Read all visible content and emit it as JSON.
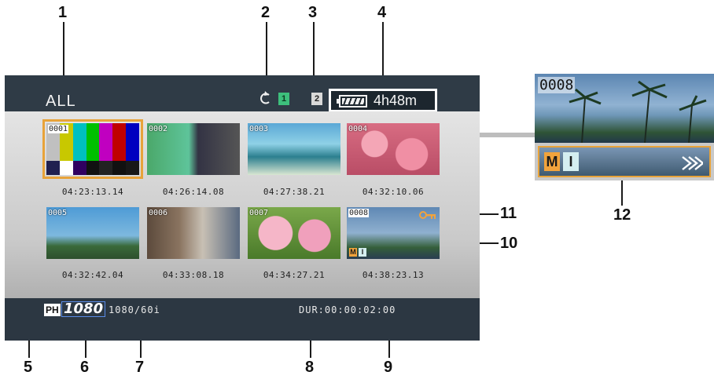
{
  "callouts": [
    "1",
    "2",
    "3",
    "4",
    "5",
    "6",
    "7",
    "8",
    "9",
    "10",
    "11",
    "12"
  ],
  "screen": {
    "title": "ALL",
    "slot1_label": "1",
    "slot2_label": "2",
    "battery_time": "4h48m",
    "format_badge": "PH",
    "resolution_badge": "1080",
    "recording_format": "1080/60i",
    "duration": "DUR:00:00:02:00"
  },
  "clips": [
    {
      "number": "0001",
      "timecode": "04:23:13.14",
      "selected": true
    },
    {
      "number": "0002",
      "timecode": "04:26:14.08"
    },
    {
      "number": "0003",
      "timecode": "04:27:38.21"
    },
    {
      "number": "0004",
      "timecode": "04:32:10.06"
    },
    {
      "number": "0005",
      "timecode": "04:32:42.04"
    },
    {
      "number": "0006",
      "timecode": "04:33:08.18"
    },
    {
      "number": "0007",
      "timecode": "04:34:27.21"
    },
    {
      "number": "0008",
      "timecode": "04:38:23.13",
      "marked": "M",
      "index": "I",
      "protected": true
    }
  ],
  "zoom": {
    "number": "0008",
    "mark_label": "M",
    "index_label": "I",
    "icons": [
      "key-icon",
      "fast-forward-icon",
      "cycle-icon",
      "battery-icon"
    ]
  },
  "colors": {
    "accent": "#e8a33a",
    "mark": "#f1a33c",
    "index": "#d4eef0",
    "slot_active": "#3dbf7c"
  }
}
